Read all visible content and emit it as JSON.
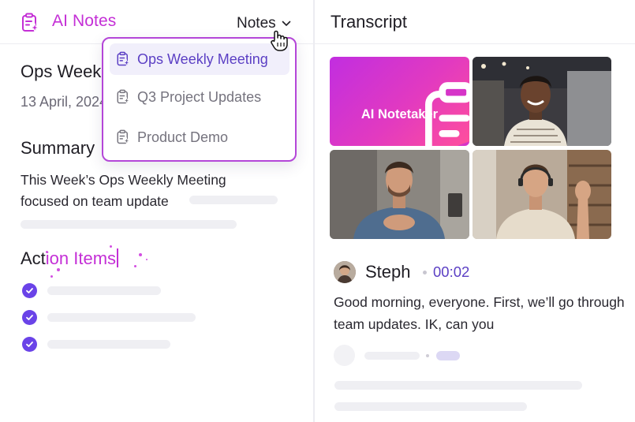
{
  "app": {
    "brand_title": "AI Notes",
    "brand_icon": "notes-sparkle-icon",
    "accent_color": "#c42fd6",
    "primary_color": "#6a43e8"
  },
  "header": {
    "notes_button_label": "Notes",
    "chevron_icon": "chevron-down-icon"
  },
  "dropdown": {
    "items": [
      {
        "label": "Ops Weekly Meeting",
        "icon": "notes-sparkle-icon",
        "selected": true
      },
      {
        "label": "Q3 Project Updates",
        "icon": "notes-sparkle-icon",
        "selected": false
      },
      {
        "label": "Product Demo",
        "icon": "notes-sparkle-icon",
        "selected": false
      }
    ]
  },
  "note": {
    "title": "Ops Weekly Meeting",
    "date": "13 April, 2024",
    "summary_heading": "Summary",
    "summary_text": "This Week’s Ops Weekly Meeting focused on team update",
    "action_heading_static": "Act",
    "action_heading_typing": "ion Items",
    "action_items_count": 3
  },
  "transcript": {
    "title": "Transcript",
    "notetaker_label": "AI Notetaker",
    "speaker_name": "Steph",
    "timestamp": "00:02",
    "text": "Good morning, everyone. First, we’ll go through team updates. IK, can you"
  }
}
